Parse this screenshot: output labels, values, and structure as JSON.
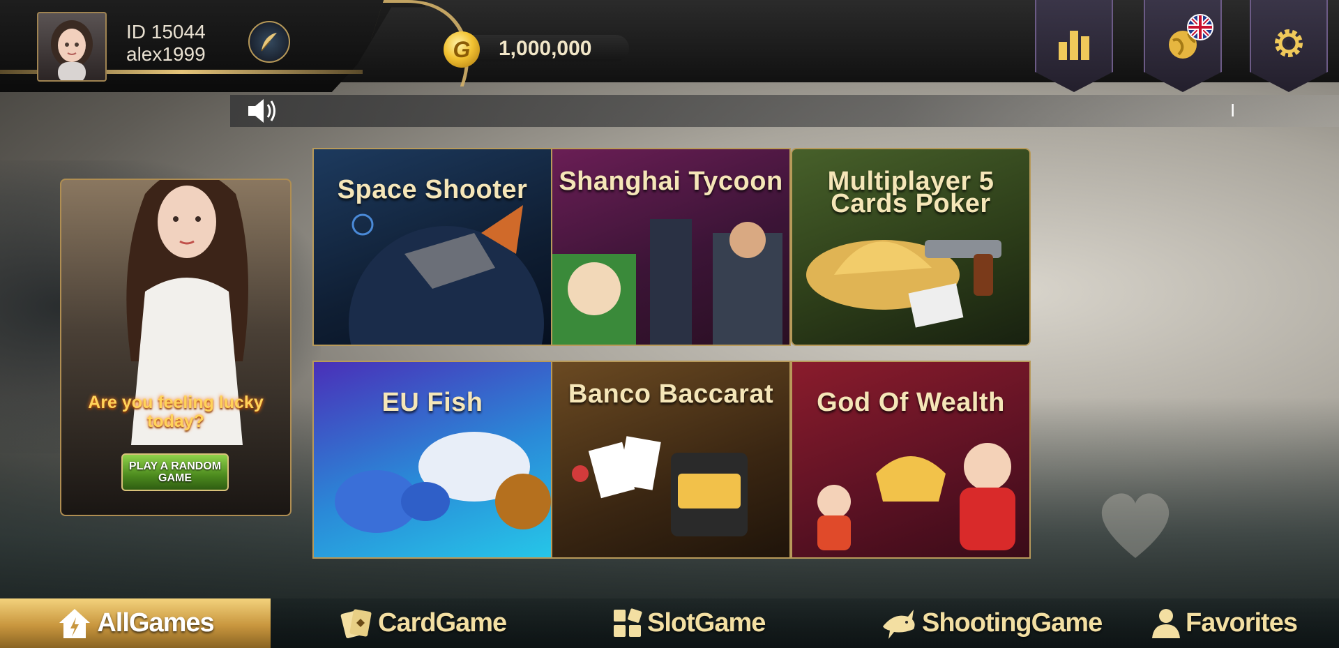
{
  "user": {
    "id_text": "ID 15044",
    "username": "alex1999"
  },
  "balance": {
    "amount": "1,000,000",
    "coin_letter": "G"
  },
  "marquee": {
    "text": "I"
  },
  "promo": {
    "headline": "Are you feeling lucky today?",
    "button_label": "PLAY A RANDOM GAME"
  },
  "games": [
    {
      "title": "Space Shooter"
    },
    {
      "title": "Shanghai Tycoon"
    },
    {
      "title": "Multiplayer 5 Cards Poker"
    },
    {
      "title": "EU Fish"
    },
    {
      "title": "Banco Baccarat"
    },
    {
      "title": "God Of Wealth"
    }
  ],
  "nav": {
    "items": [
      {
        "label": "AllGames",
        "icon": "house-icon",
        "active": true
      },
      {
        "label": "CardGame",
        "icon": "cards-icon",
        "active": false
      },
      {
        "label": "SlotGame",
        "icon": "grid-icon",
        "active": false
      },
      {
        "label": "ShootingGame",
        "icon": "shark-icon",
        "active": false
      },
      {
        "label": "Favorites",
        "icon": "person-icon",
        "active": false
      }
    ]
  },
  "colors": {
    "gold": "#d4b26a",
    "active_tab": "#c8963e",
    "nav_text": "#f3dfa2"
  }
}
